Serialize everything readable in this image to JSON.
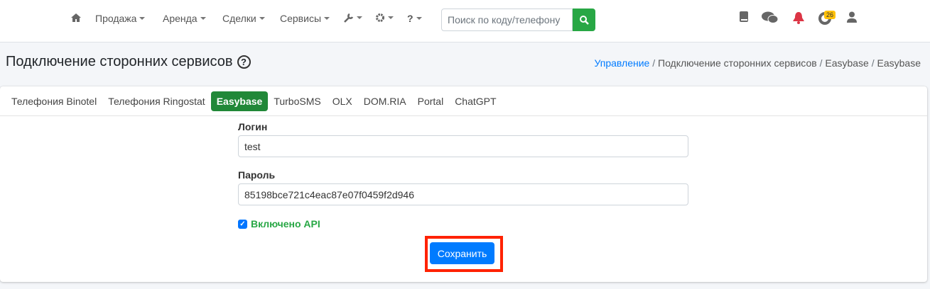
{
  "navbar": {
    "items": [
      {
        "label": "Продажа"
      },
      {
        "label": "Аренда"
      },
      {
        "label": "Сделки"
      },
      {
        "label": "Сервисы"
      }
    ],
    "search_placeholder": "Поиск по коду/телефону",
    "notification_count": "26"
  },
  "page": {
    "title": "Подключение сторонних сервисов",
    "breadcrumb": [
      "Управление",
      "Подключение сторонних сервисов",
      "Easybase",
      "Easybase"
    ]
  },
  "tabs": [
    {
      "label": "Телефония Binotel"
    },
    {
      "label": "Телефония Ringostat"
    },
    {
      "label": "Easybase",
      "active": true
    },
    {
      "label": "TurboSMS"
    },
    {
      "label": "OLX"
    },
    {
      "label": "DOM.RIA"
    },
    {
      "label": "Portal"
    },
    {
      "label": "ChatGPT"
    }
  ],
  "form": {
    "login_label": "Логин",
    "login_value": "test",
    "password_label": "Пароль",
    "password_value": "85198bce721c4eac87e07f0459f2d946",
    "api_label": "Включено API",
    "api_enabled": true,
    "save_label": "Сохранить"
  },
  "colors": {
    "accent": "#007bff",
    "success": "#28a745",
    "highlight": "#ff2200"
  }
}
